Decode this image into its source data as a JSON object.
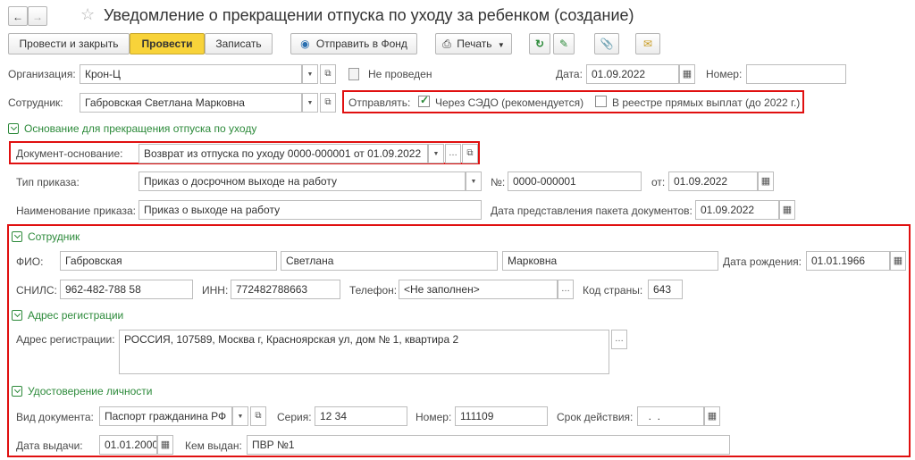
{
  "window": {
    "title": "Уведомление о прекращении отпуска по уходу за ребенком (создание)"
  },
  "toolbar": {
    "post_close_label": "Провести и закрыть",
    "post_label": "Провести",
    "save_label": "Записать",
    "send_fund_label": "Отправить в Фонд",
    "print_label": "Печать"
  },
  "header": {
    "org_label": "Организация:",
    "org_value": "Крон-Ц",
    "status_text": "Не проведен",
    "date_label": "Дата:",
    "date_value": "01.09.2022",
    "number_label": "Номер:",
    "number_value": "",
    "employee_label": "Сотрудник:",
    "employee_value": "Габровская Светлана Марковна",
    "send_label": "Отправлять:",
    "send_sedo_label": "Через СЭДО (рекомендуется)",
    "send_sedo_checked": true,
    "send_registry_label": "В реестре прямых выплат (до 2022 г.)",
    "send_registry_checked": false
  },
  "basis": {
    "section_title": "Основание для прекращения отпуска по уходу",
    "doc_basis_label": "Документ-основание:",
    "doc_basis_value": "Возврат из отпуска по уходу 0000-000001 от 01.09.2022",
    "order_type_label": "Тип приказа:",
    "order_type_value": "Приказ о досрочном выходе на работу",
    "order_no_label": "№:",
    "order_no_value": "0000-000001",
    "order_from_label": "от:",
    "order_from_value": "01.09.2022",
    "order_name_label": "Наименование приказа:",
    "order_name_value": "Приказ о выходе на работу",
    "package_date_label": "Дата представления пакета документов:",
    "package_date_value": "01.09.2022"
  },
  "employee": {
    "section_title": "Сотрудник",
    "fio_label": "ФИО:",
    "last_name": "Габровская",
    "first_name": "Светлана",
    "middle_name": "Марковна",
    "birth_label": "Дата рождения:",
    "birth_value": "01.01.1966",
    "snils_label": "СНИЛС:",
    "snils_value": "962-482-788 58",
    "inn_label": "ИНН:",
    "inn_value": "772482788663",
    "phone_label": "Телефон:",
    "phone_value": "<Не заполнен>",
    "country_label": "Код страны:",
    "country_value": "643"
  },
  "address": {
    "section_title": "Адрес регистрации",
    "label": "Адрес регистрации:",
    "value": "РОССИЯ, 107589, Москва г, Красноярская ул, дом № 1, квартира 2"
  },
  "identity": {
    "section_title": "Удостоверение личности",
    "doc_type_label": "Вид документа:",
    "doc_type_value": "Паспорт гражданина РФ",
    "series_label": "Серия:",
    "series_value": "12 34",
    "number_label": "Номер:",
    "number_value": "111109",
    "validity_label": "Срок действия:",
    "validity_value": "  .  .",
    "issue_date_label": "Дата выдачи:",
    "issue_date_value": "01.01.2000",
    "issued_by_label": "Кем выдан:",
    "issued_by_value": "ПВР №1"
  }
}
